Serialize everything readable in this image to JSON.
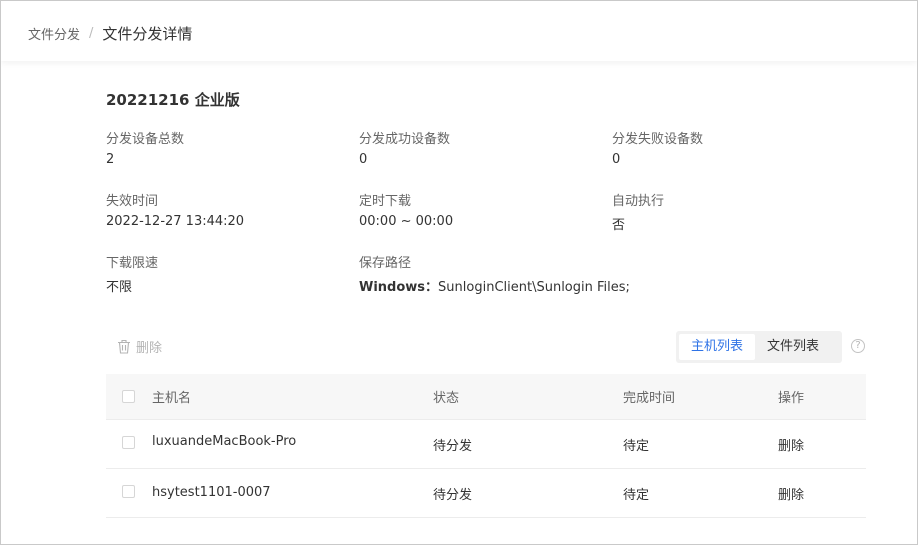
{
  "breadcrumb": {
    "parent": "文件分发",
    "separator": "/",
    "current": "文件分发详情"
  },
  "task_title": "20221216 企业版",
  "info": {
    "total_devices": {
      "label": "分发设备总数",
      "value": "2"
    },
    "success_devices": {
      "label": "分发成功设备数",
      "value": "0"
    },
    "failed_devices": {
      "label": "分发失败设备数",
      "value": "0"
    },
    "expire_time": {
      "label": "失效时间",
      "value": "2022-12-27 13:44:20"
    },
    "scheduled_download": {
      "label": "定时下载",
      "value": "00:00 ~ 00:00"
    },
    "auto_execute": {
      "label": "自动执行",
      "value": "否"
    },
    "speed_limit": {
      "label": "下载限速",
      "value": "不限"
    },
    "save_path": {
      "label": "保存路径",
      "os": "Windows：",
      "path": "SunloginClient\\Sunlogin Files;"
    }
  },
  "toolbar": {
    "delete_label": "删除",
    "tabs": [
      "主机列表",
      "文件列表"
    ],
    "active_tab": 0,
    "help_glyph": "?"
  },
  "table": {
    "columns": [
      "主机名",
      "状态",
      "完成时间",
      "操作"
    ],
    "rows": [
      {
        "host": "luxuandeMacBook-Pro",
        "status": "待分发",
        "finish_time": "待定",
        "action": "删除"
      },
      {
        "host": "hsytest1101-0007",
        "status": "待分发",
        "finish_time": "待定",
        "action": "删除"
      }
    ]
  },
  "colors": {
    "accent": "#2f73e6",
    "header_bg": "#f7f7f7",
    "muted_text": "#666666"
  },
  "icons": {
    "delete": "trash-icon",
    "help": "question-circle-icon"
  }
}
